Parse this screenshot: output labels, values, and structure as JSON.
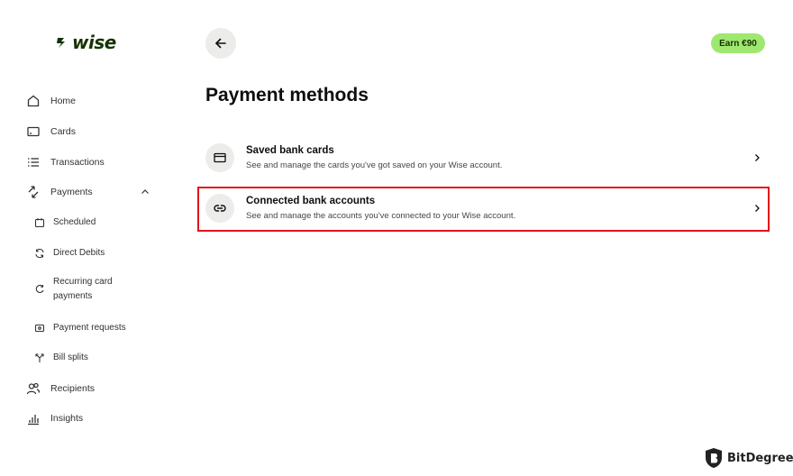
{
  "brand": {
    "name": "wise"
  },
  "nav": {
    "items": [
      {
        "label": "Home",
        "icon": "home-icon"
      },
      {
        "label": "Cards",
        "icon": "card-icon"
      },
      {
        "label": "Transactions",
        "icon": "list-icon"
      },
      {
        "label": "Payments",
        "icon": "payments-arrows-icon"
      }
    ],
    "payments_sub": [
      {
        "label": "Scheduled",
        "icon": "calendar-icon"
      },
      {
        "label": "Direct Debits",
        "icon": "refresh-icon"
      },
      {
        "label": "Recurring card\npayments",
        "icon": "recurring-icon"
      },
      {
        "label": "Payment requests",
        "icon": "request-icon"
      },
      {
        "label": "Bill splits",
        "icon": "split-icon"
      }
    ],
    "items_after": [
      {
        "label": "Recipients",
        "icon": "recipients-icon"
      },
      {
        "label": "Insights",
        "icon": "bar-chart-icon"
      }
    ]
  },
  "header": {
    "back_icon": "arrow-left-icon",
    "earn_label": "Earn €90"
  },
  "main": {
    "title": "Payment methods",
    "rows": [
      {
        "title": "Saved bank cards",
        "subtitle": "See and manage the cards you've got saved on your Wise account.",
        "icon": "card-icon"
      },
      {
        "title": "Connected bank accounts",
        "subtitle": "See and manage the accounts you've connected to your Wise account.",
        "icon": "link-icon"
      }
    ]
  },
  "watermark": {
    "text": "BitDegree"
  },
  "colors": {
    "brand_green": "#163300",
    "accent_green": "#9fe870",
    "highlight_red": "#e3111b",
    "icon_bg": "#ececea"
  }
}
